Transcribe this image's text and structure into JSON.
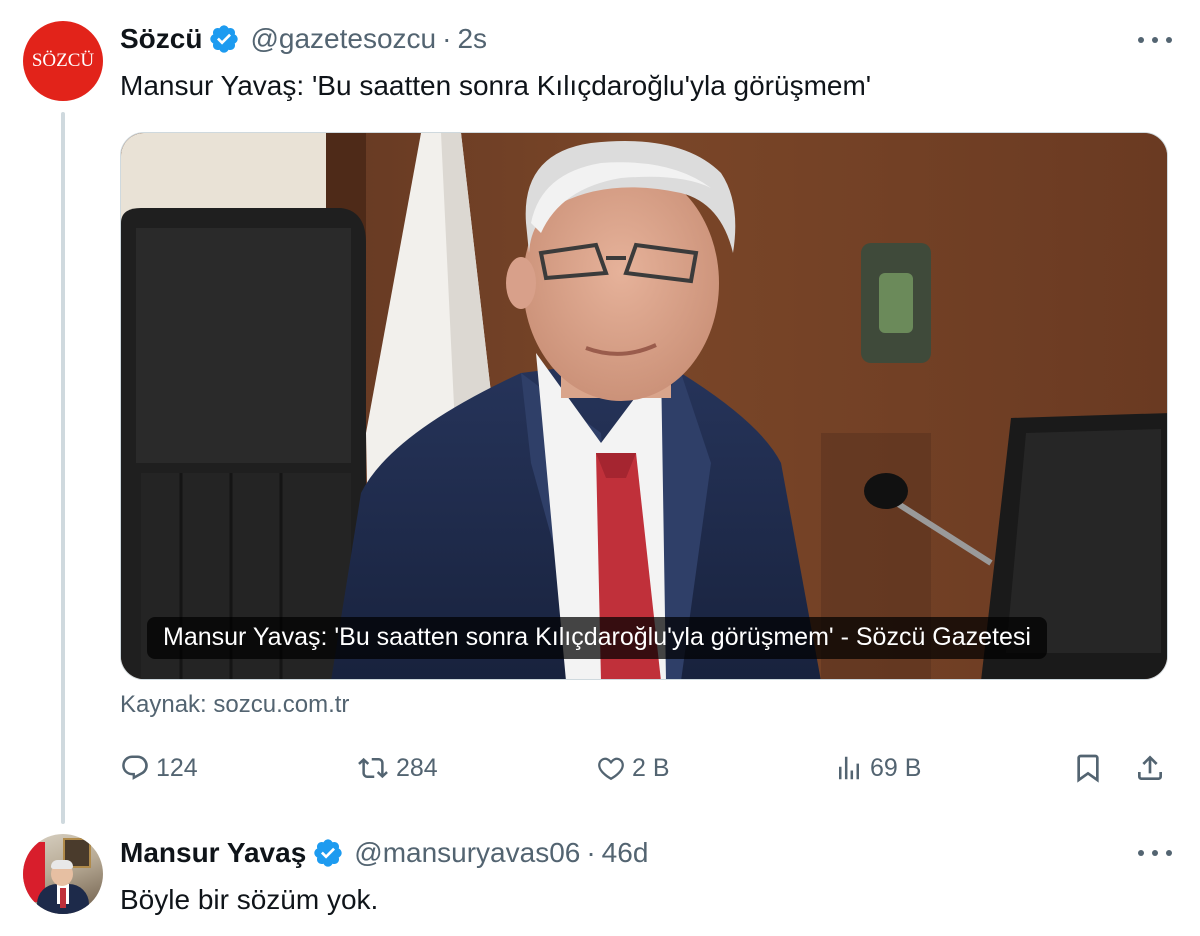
{
  "colors": {
    "brand_red": "#e2231a",
    "verified_blue": "#1d9bf0",
    "secondary_text": "#536471",
    "thread_line": "#cfd9de"
  },
  "tweet1": {
    "avatar_text": "SÖZCÜ",
    "display_name": "Sözcü",
    "verified_icon": "verified-badge-icon",
    "handle": "@gazetesozcu",
    "separator": "·",
    "time": "2s",
    "more_icon": "more-icon",
    "text": "Mansur Yavaş: 'Bu saatten sonra Kılıçdaroğlu'yla görüşmem'",
    "card": {
      "caption": "Mansur Yavaş: 'Bu saatten sonra Kılıçdaroğlu'yla görüşmem' - Sözcü Gazetesi",
      "source": "Kaynak: sozcu.com.tr"
    },
    "actions": {
      "replies": "124",
      "retweets": "284",
      "likes": "2 B",
      "views": "69 B",
      "icons": [
        "reply-icon",
        "retweet-icon",
        "like-icon",
        "views-icon",
        "bookmark-icon",
        "share-icon"
      ]
    }
  },
  "tweet2": {
    "display_name": "Mansur Yavaş",
    "verified_icon": "verified-badge-icon",
    "handle": "@mansuryavas06",
    "separator": "·",
    "time": "46d",
    "more_icon": "more-icon",
    "text": "Böyle bir sözüm yok."
  }
}
